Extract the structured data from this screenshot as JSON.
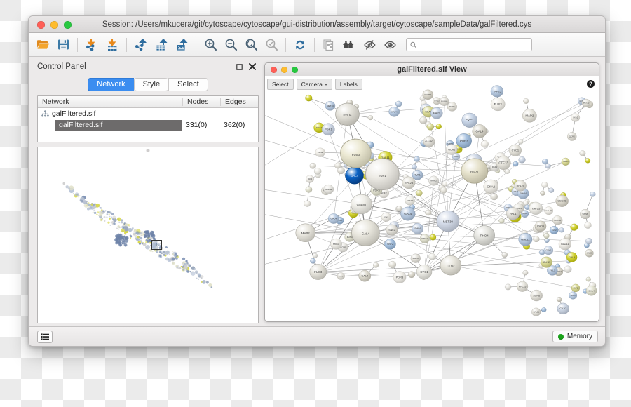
{
  "window": {
    "title": "Session: /Users/mkucera/git/cytoscape/cytoscape/gui-distribution/assembly/target/cytoscape/sampleData/galFiltered.cys",
    "traffic": {
      "close": "close-button",
      "minimize": "minimize-button",
      "zoom": "zoom-button"
    }
  },
  "toolbar": {
    "buttons": [
      {
        "name": "open-session",
        "icon": "folder-open-icon",
        "tooltip": "Open Session",
        "enabled": true
      },
      {
        "name": "save-session",
        "icon": "floppy-save-icon",
        "tooltip": "Save Session",
        "enabled": true
      },
      {
        "name": "import-network",
        "icon": "import-network-icon",
        "tooltip": "Import Network From File",
        "enabled": true
      },
      {
        "name": "import-table",
        "icon": "import-table-icon",
        "tooltip": "Import Table From File",
        "enabled": true
      },
      {
        "name": "export-network",
        "icon": "export-network-icon",
        "tooltip": "Export Network",
        "enabled": true
      },
      {
        "name": "export-table",
        "icon": "export-table-icon",
        "tooltip": "Export Table",
        "enabled": true
      },
      {
        "name": "export-image",
        "icon": "export-image-icon",
        "tooltip": "Export Network Image",
        "enabled": true
      },
      {
        "name": "zoom-in",
        "icon": "zoom-in-icon",
        "tooltip": "Zoom In",
        "enabled": true
      },
      {
        "name": "zoom-out",
        "icon": "zoom-out-icon",
        "tooltip": "Zoom Out",
        "enabled": true
      },
      {
        "name": "zoom-selected",
        "icon": "zoom-selected-icon",
        "tooltip": "Zoom Selected Region",
        "enabled": true
      },
      {
        "name": "fit-selected",
        "icon": "fit-selected-icon",
        "tooltip": "Fit Selected",
        "enabled": false
      },
      {
        "name": "apply-layout",
        "icon": "refresh-layout-icon",
        "tooltip": "Apply Preferred Layout",
        "enabled": true
      },
      {
        "name": "new-network-from-selection",
        "icon": "new-network-icon",
        "tooltip": "New Network From Selection",
        "enabled": false
      },
      {
        "name": "fit-network",
        "icon": "home-fit-icon",
        "tooltip": "Zoom Out To Display All",
        "enabled": true
      },
      {
        "name": "hide-unselected",
        "icon": "eye-slash-icon",
        "tooltip": "Hide Unselected",
        "enabled": true
      },
      {
        "name": "show-all",
        "icon": "eye-icon",
        "tooltip": "Show All Nodes And Edges",
        "enabled": true
      }
    ],
    "search": {
      "value": "",
      "placeholder": "",
      "icon": "search-icon"
    }
  },
  "control_panel": {
    "title": "Control Panel",
    "maximize_icon": "maximize-square-icon",
    "close_icon": "close-x-icon",
    "tabs": [
      {
        "label": "Network",
        "active": true
      },
      {
        "label": "Style",
        "active": false
      },
      {
        "label": "Select",
        "active": false
      }
    ],
    "network_table": {
      "columns": [
        "Network",
        "Nodes",
        "Edges"
      ],
      "root": {
        "label": "galFiltered.sif",
        "icon": "network-collection-icon"
      },
      "rows": [
        {
          "name": "galFiltered.sif",
          "nodes": "331(0)",
          "edges": "362(0)",
          "selected": true
        }
      ]
    },
    "overview": {
      "name": "network-overview-birdseye",
      "viewport_label": "viewport-rectangle"
    }
  },
  "network_view": {
    "title": "galFiltered.sif View",
    "overlay_buttons": [
      {
        "label": "Select",
        "name": "select-mode-button",
        "has_caret": false
      },
      {
        "label": "Camera",
        "name": "camera-mode-button",
        "has_caret": true
      },
      {
        "label": "Labels",
        "name": "labels-toggle-button",
        "has_caret": false
      }
    ],
    "help_icon": "help-question-icon"
  },
  "status_bar": {
    "menu_icon": "list-menu-icon",
    "memory": {
      "label": "Memory",
      "indicator_color": "#19a319"
    }
  },
  "colors": {
    "accent": "#3b8df0",
    "selected_node": "#0b63c5",
    "toolbar_orange": "#e8891c",
    "toolbar_blue": "#2f6d9e",
    "disabled_gray": "#a9a9a9",
    "row_selection": "#6d6b6b"
  }
}
